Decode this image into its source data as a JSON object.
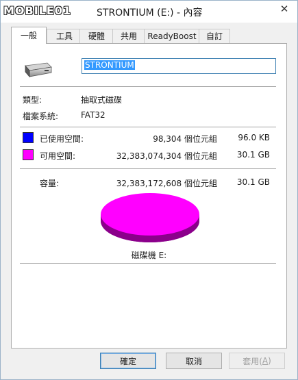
{
  "titlebar": {
    "logo_text": "MOBILE01",
    "title": "STRONTIUM (E:) - 內容",
    "close_glyph": "✕"
  },
  "tabs": [
    {
      "label": "一般",
      "active": true
    },
    {
      "label": "工具",
      "active": false
    },
    {
      "label": "硬體",
      "active": false
    },
    {
      "label": "共用",
      "active": false
    },
    {
      "label": "ReadyBoost",
      "active": false
    },
    {
      "label": "自訂",
      "active": false
    }
  ],
  "general": {
    "drive_name": "STRONTIUM",
    "type_label": "類型:",
    "type_value": "抽取式磁碟",
    "fs_label": "檔案系統:",
    "fs_value": "FAT32",
    "used_label": "已使用空間:",
    "used_bytes": "98,304 個位元組",
    "used_size": "96.0 KB",
    "free_label": "可用空間:",
    "free_bytes": "32,383,074,304 個位元組",
    "free_size": "30.1 GB",
    "capacity_label": "容量:",
    "capacity_bytes": "32,383,172,608 個位元組",
    "capacity_size": "30.1 GB",
    "drive_caption": "磁碟機 E:",
    "used_fraction": 3e-06
  },
  "colors": {
    "used": "#0000ff",
    "free": "#ff00ff",
    "free_shadow": "#8b008b"
  },
  "buttons": {
    "ok": "確定",
    "cancel": "取消",
    "apply": "套用(",
    "apply_key": "A",
    "apply_close": ")"
  },
  "icons": {
    "drive": "usb-drive-icon",
    "close": "close-icon",
    "logo": "mobile01-logo"
  }
}
